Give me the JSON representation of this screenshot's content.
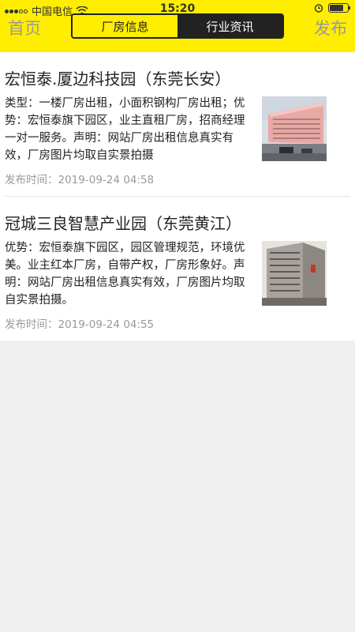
{
  "status_bar": {
    "carrier": "中国电信",
    "time": "15:20"
  },
  "nav": {
    "left": "首页",
    "right": "发布",
    "tabs": [
      {
        "label": "厂房信息",
        "active": true
      },
      {
        "label": "行业资讯",
        "active": false
      }
    ]
  },
  "listings": [
    {
      "title": "宏恒泰.厦边科技园（东莞长安）",
      "desc": "类型：一楼厂房出租，小面积钢构厂房出租；优势：宏恒泰旗下园区，业主直租厂房，招商经理一对一服务。声明：网站厂房出租信息真实有效，厂房图片均取自实景拍摄",
      "time": "发布时间：2019-09-24 04:58"
    },
    {
      "title": "冠城三良智慧产业园（东莞黄江）",
      "desc": "优势：宏恒泰旗下园区，园区管理规范，环境优美。业主红本厂房，自带产权，厂房形象好。声明：网站厂房出租信息真实有效，厂房图片均取自实景拍摄。",
      "time": "发布时间：2019-09-24 04:55"
    }
  ],
  "battery_level": 0.75
}
